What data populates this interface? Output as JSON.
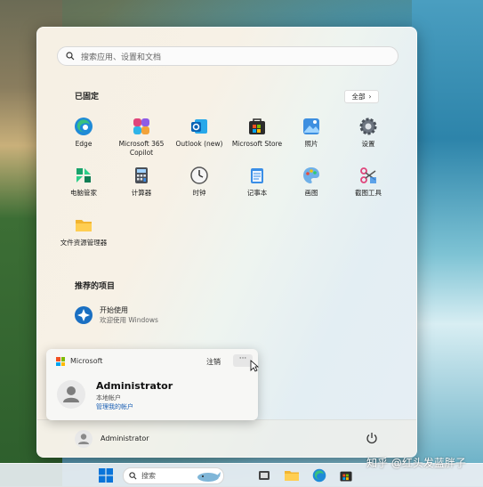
{
  "search": {
    "placeholder": "搜索应用、设置和文档"
  },
  "pinned": {
    "title": "已固定",
    "all_label": "全部",
    "apps": [
      {
        "label": "Edge",
        "icon": "edge-icon"
      },
      {
        "label": "Microsoft 365 Copilot",
        "icon": "copilot-icon"
      },
      {
        "label": "Outlook (new)",
        "icon": "outlook-icon"
      },
      {
        "label": "Microsoft Store",
        "icon": "store-icon"
      },
      {
        "label": "照片",
        "icon": "photos-icon"
      },
      {
        "label": "设置",
        "icon": "settings-icon"
      },
      {
        "label": "电脑管家",
        "icon": "pc-manager-icon"
      },
      {
        "label": "计算器",
        "icon": "calculator-icon"
      },
      {
        "label": "时钟",
        "icon": "clock-icon"
      },
      {
        "label": "记事本",
        "icon": "notepad-icon"
      },
      {
        "label": "画图",
        "icon": "paint-icon"
      },
      {
        "label": "截图工具",
        "icon": "snipping-tool-icon"
      },
      {
        "label": "文件资源管理器",
        "icon": "file-explorer-icon"
      }
    ]
  },
  "recommended": {
    "title": "推荐的项目",
    "items": [
      {
        "title": "开始使用",
        "subtitle": "欢迎使用 Windows"
      }
    ]
  },
  "account_popup": {
    "brand": "Microsoft",
    "signout": "注销",
    "more": "···",
    "user_name": "Administrator",
    "account_type": "本地帐户",
    "manage_link": "管理我的帐户"
  },
  "footer": {
    "user_name": "Administrator"
  },
  "taskbar": {
    "search_label": "搜索"
  },
  "watermark": "知乎 @红头发蓝胖子"
}
